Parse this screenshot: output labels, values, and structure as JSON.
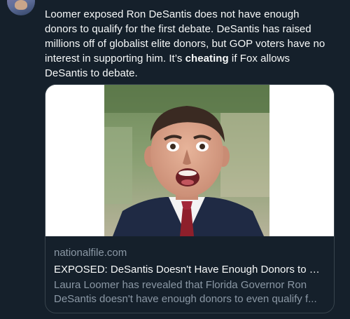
{
  "tweet": {
    "text_lines": [
      "Loomer exposed Ron DeSantis does not have enough",
      "donors to qualify for the first debate. DeSantis has raised",
      "millions off of globalist elite donors, but GOP voters have no",
      "interest in supporting him. It’s "
    ],
    "bold_word": "cheating",
    "after_bold": " if Fox allows",
    "last_line": "DeSantis to debate."
  },
  "card": {
    "image_icon": "news-photo-image",
    "domain": "nationalfile.com",
    "title": "EXPOSED: DeSantis Doesn't Have Enough Donors to Q...",
    "description_lines": [
      "Laura Loomer has revealed that Florida Governor Ron",
      "DeSantis doesn't have enough donors to even qualify f..."
    ]
  },
  "colors": {
    "background": "#15202b",
    "text_primary": "#f7f9f9",
    "text_secondary": "#8b98a5",
    "border": "#38444d"
  }
}
